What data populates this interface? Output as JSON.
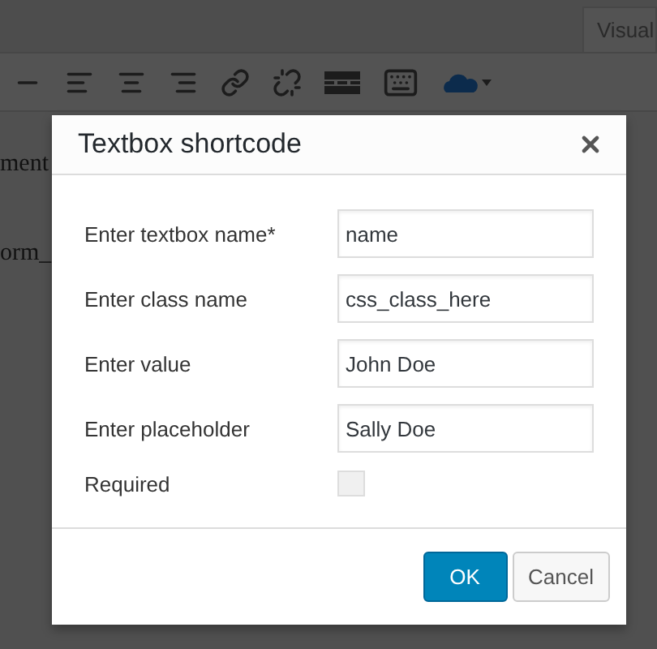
{
  "editor": {
    "tabs": [
      {
        "label": "Visual"
      }
    ],
    "toolbar": [
      {
        "kind": "horizontal-line"
      },
      {
        "kind": "align-left"
      },
      {
        "kind": "align-center"
      },
      {
        "kind": "align-right"
      },
      {
        "kind": "link"
      },
      {
        "kind": "unlink"
      },
      {
        "kind": "read-more"
      },
      {
        "kind": "keyboard"
      },
      {
        "kind": "cloud"
      }
    ],
    "text_lines": [
      "ment",
      "orm_"
    ]
  },
  "dialog": {
    "title": "Textbox shortcode",
    "fields": [
      {
        "kind": "text",
        "label": "Enter textbox name*",
        "value": "name"
      },
      {
        "kind": "text",
        "label": "Enter class name",
        "value": "css_class_here"
      },
      {
        "kind": "text",
        "label": "Enter value",
        "value": "John Doe"
      },
      {
        "kind": "text",
        "label": "Enter placeholder",
        "value": "Sally Doe"
      },
      {
        "kind": "checkbox",
        "label": "Required",
        "checked": false
      }
    ],
    "buttons": [
      {
        "label": "OK",
        "kind": "primary"
      },
      {
        "label": "Cancel",
        "kind": "secondary"
      }
    ]
  }
}
